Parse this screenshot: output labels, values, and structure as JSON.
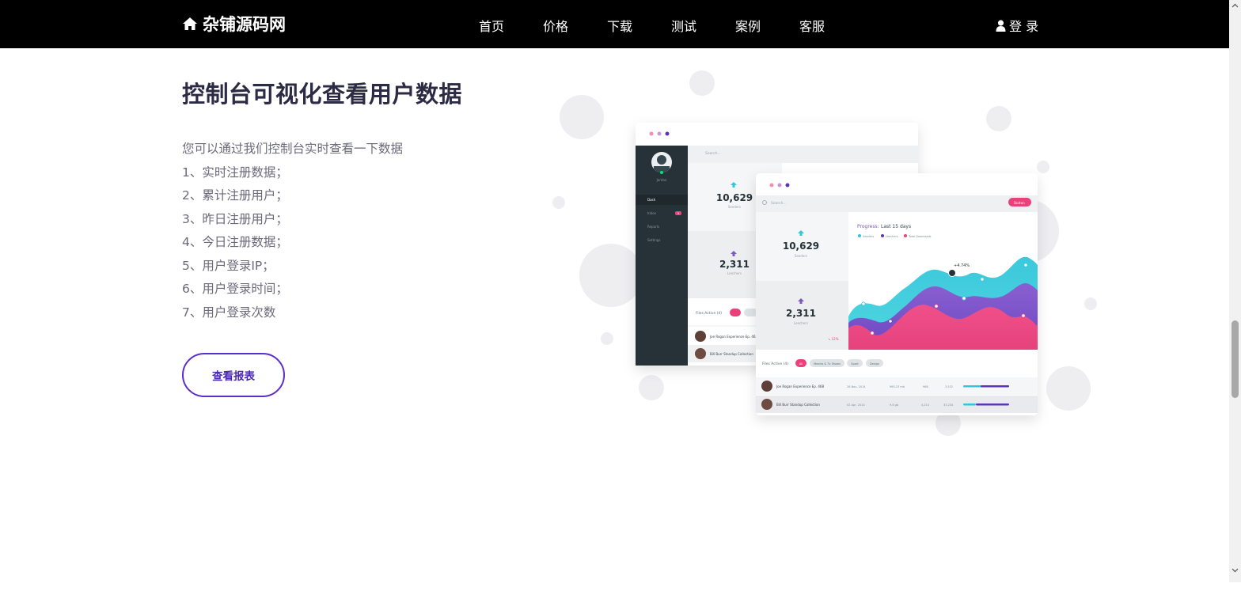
{
  "header": {
    "brand": "杂铺源码网",
    "brand_icon": "home-icon",
    "nav": [
      "首页",
      "价格",
      "下载",
      "测试",
      "案例",
      "客服"
    ],
    "login": "登 录",
    "login_icon": "user-icon"
  },
  "main": {
    "title": "控制台可视化查看用户数据",
    "intro": "您可以通过我们控制台实时查看一下数据",
    "items": [
      "1、实时注册数据；",
      "2、累计注册用户；",
      "3、昨日注册用户；",
      "4、今日注册数据；",
      "5、用户登录IP；",
      "6、用户登录时间；",
      "7、用户登录次数"
    ],
    "report_button": "查看报表"
  },
  "illustration": {
    "back_window": {
      "username": "Jordan",
      "sidebar": [
        "Dash",
        "Inbox",
        "Reports",
        "Settings"
      ],
      "inbox_count": "9",
      "search": "Search...",
      "seeders_value": "10,629",
      "seeders_label": "Seeders",
      "leechers_value": "2,311",
      "leechers_label": "Leechers",
      "files_active": "Files Active (4)",
      "files": [
        "Joe Rogan Experience Ep. 468",
        "Bill Burr Standup Collection"
      ]
    },
    "front_window": {
      "search": "Search...",
      "button": "Button",
      "seeders_value": "10,629",
      "seeders_label": "Seeders",
      "leechers_value": "2,311",
      "leechers_label": "Leechers",
      "leechers_change": "↘ 12%",
      "progress_label": "Progress:",
      "progress_range": "Last 15 days",
      "legend": [
        "Seeders",
        "Leechers",
        "Total Downloads"
      ],
      "peak_label": "+4.74%",
      "files_active": "Files Active (4)",
      "filters": [
        "All",
        "Movies & Tv Shows",
        "Sport",
        "Design"
      ],
      "rows": [
        {
          "name": "Joe Rogan Experience Ep. 468",
          "date": "26 Nov, 2014",
          "size": "965.23 mb",
          "seeds": "968",
          "peers": "3,532"
        },
        {
          "name": "Bill Burr Standup Collection",
          "date": "02 Apr, 2014",
          "size": "9.6 gb",
          "seeds": "4,214",
          "peers": "33,234"
        }
      ]
    }
  },
  "colors": {
    "accent": "#5b2ecb",
    "pink": "#ec407a",
    "cyan": "#33c6d9",
    "purple": "#7e57c2",
    "nav_bg": "#000000"
  }
}
